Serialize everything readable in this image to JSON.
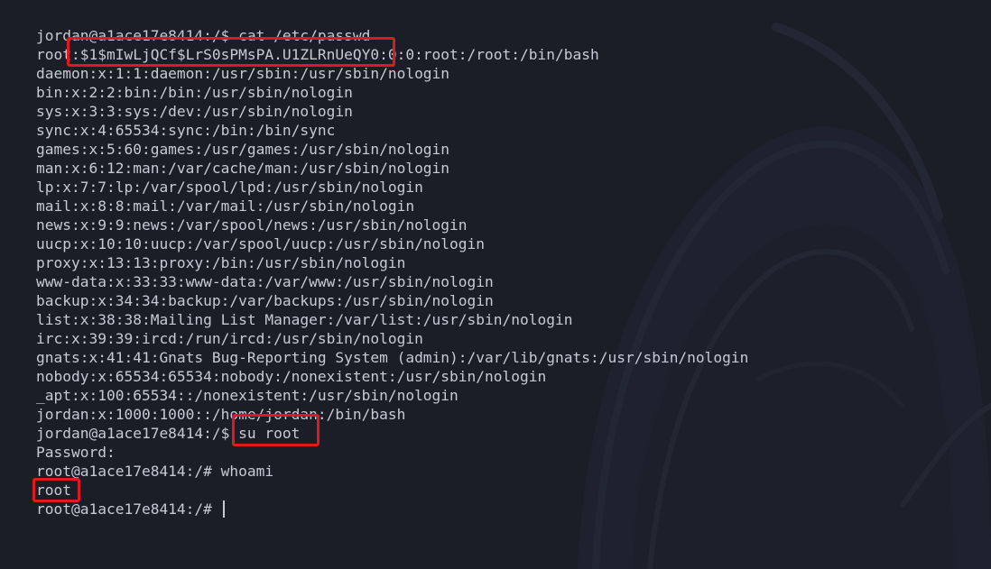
{
  "terminal": {
    "lines": [
      "jordan@a1ace17e8414:/$ cat /etc/passwd",
      "root:$1$mIwLjQCf$LrS0sPMsPA.U1ZLRnUeQY0:0:0:root:/root:/bin/bash",
      "daemon:x:1:1:daemon:/usr/sbin:/usr/sbin/nologin",
      "bin:x:2:2:bin:/bin:/usr/sbin/nologin",
      "sys:x:3:3:sys:/dev:/usr/sbin/nologin",
      "sync:x:4:65534:sync:/bin:/bin/sync",
      "games:x:5:60:games:/usr/games:/usr/sbin/nologin",
      "man:x:6:12:man:/var/cache/man:/usr/sbin/nologin",
      "lp:x:7:7:lp:/var/spool/lpd:/usr/sbin/nologin",
      "mail:x:8:8:mail:/var/mail:/usr/sbin/nologin",
      "news:x:9:9:news:/var/spool/news:/usr/sbin/nologin",
      "uucp:x:10:10:uucp:/var/spool/uucp:/usr/sbin/nologin",
      "proxy:x:13:13:proxy:/bin:/usr/sbin/nologin",
      "www-data:x:33:33:www-data:/var/www:/usr/sbin/nologin",
      "backup:x:34:34:backup:/var/backups:/usr/sbin/nologin",
      "list:x:38:38:Mailing List Manager:/var/list:/usr/sbin/nologin",
      "irc:x:39:39:ircd:/run/ircd:/usr/sbin/nologin",
      "gnats:x:41:41:Gnats Bug-Reporting System (admin):/var/lib/gnats:/usr/sbin/nologin",
      "nobody:x:65534:65534:nobody:/nonexistent:/usr/sbin/nologin",
      "_apt:x:100:65534::/nonexistent:/usr/sbin/nologin",
      "jordan:x:1000:1000::/home/jordan:/bin/bash",
      "jordan@a1ace17e8414:/$ su root",
      "Password:",
      "root@a1ace17e8414:/# whoami",
      "root",
      "root@a1ace17e8414:/# "
    ]
  },
  "colors": {
    "background": "#1b1e27",
    "text": "#c7cad6",
    "highlight_box": "#e01820"
  },
  "icons": {
    "background": "hooded-figure-watermark-icon",
    "cursor": "text-cursor"
  }
}
